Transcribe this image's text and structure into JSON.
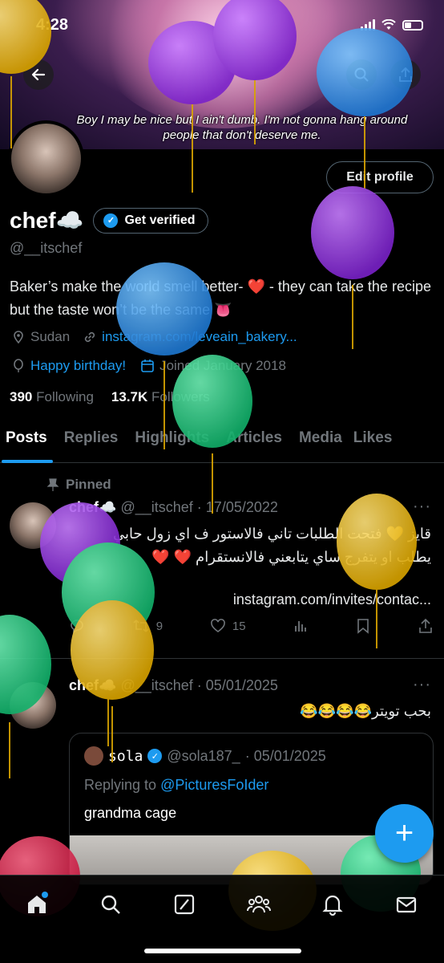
{
  "status_bar": {
    "time": "4:28"
  },
  "banner": {
    "caption": "Boy I may be nice but I ain't dumb. I'm not gonna hang around people that don't deserve me."
  },
  "header": {
    "back_icon": "arrow-left-icon",
    "search_icon": "search-icon",
    "share_icon": "share-icon"
  },
  "profile": {
    "edit_label": "Edit profile",
    "display_name": "chef",
    "name_emoji": "☁️",
    "verify_label": "Get verified",
    "handle": "@__itschef",
    "bio": "Baker’s make the world smell better- ❤️ - they can take the recipe but the taste won’t be the same 👅",
    "location": "Sudan",
    "website": "instagram.com/leveain_bakery...",
    "birthday": "Happy birthday!",
    "joined": "Joined January 2018",
    "following_count": "390",
    "following_label": "Following",
    "followers_count": "13.7K",
    "followers_label": "Followers"
  },
  "tabs": [
    {
      "label": "Posts"
    },
    {
      "label": "Replies"
    },
    {
      "label": "Highlights"
    },
    {
      "label": "Articles"
    },
    {
      "label": "Media"
    },
    {
      "label": "Likes"
    }
  ],
  "posts": [
    {
      "pinned_label": "Pinned",
      "name": "chef☁️",
      "handle": "@__itschef",
      "date": "· 17/05/2022",
      "line1": "قايز 💛 فتحت الطلبات تاني فالاستور ف اي زول حابي",
      "line2": "يطلب او يتفرج ساي يتابعني فالانستقرام ❤️ ❤️",
      "link": "instagram.com/invites/contac...",
      "retweets": "9",
      "likes": "15"
    },
    {
      "name": "chef☁️",
      "handle": "@__itschef",
      "date": "· 05/01/2025",
      "text": "بحب تويتر😂😂😂😂",
      "quote": {
        "name": "sola",
        "handle": "@sola187_",
        "date": "· 05/01/2025",
        "replying_to": "Replying to",
        "replying_handle": "@PicturesFoIder",
        "text": "grandma cage"
      }
    }
  ],
  "fab_label": "+",
  "nav": [
    "home-icon",
    "search-icon",
    "grok-icon",
    "communities-icon",
    "notifications-icon",
    "messages-icon"
  ],
  "colors": {
    "accent": "#1d9bf0",
    "background": "#000000",
    "muted": "#71767b",
    "heart": "#e0245e"
  }
}
